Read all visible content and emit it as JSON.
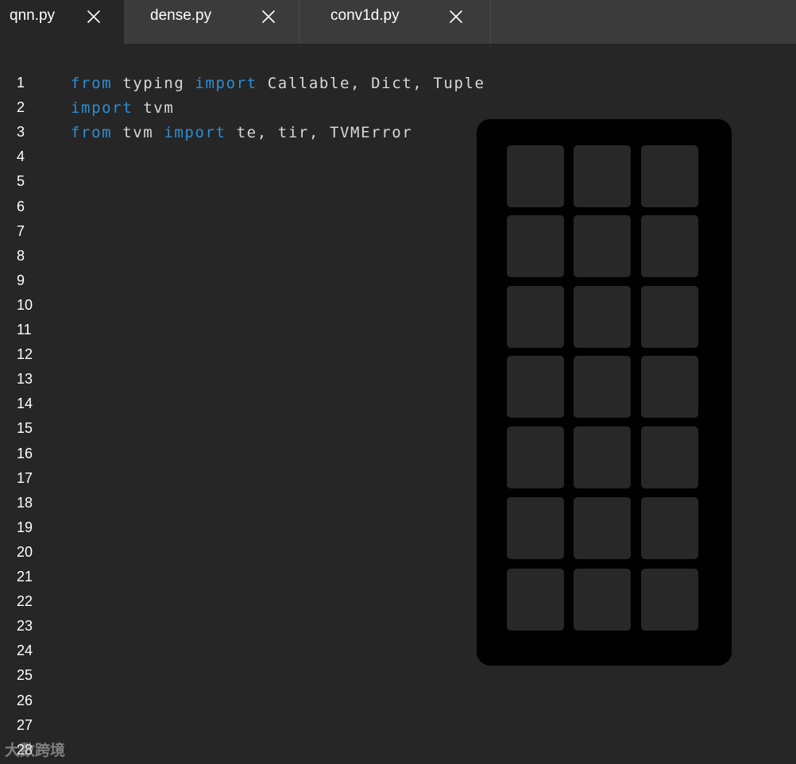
{
  "tabs": [
    {
      "label": "qnn.py",
      "active": true
    },
    {
      "label": "dense.py",
      "active": false
    },
    {
      "label": "conv1d.py",
      "active": false
    }
  ],
  "editor": {
    "line_numbers": [
      "1",
      "2",
      "3",
      "4",
      "5",
      "6",
      "7",
      "8",
      "9",
      "10",
      "11",
      "12",
      "13",
      "14",
      "15",
      "16",
      "17",
      "18",
      "19",
      "20",
      "21",
      "22",
      "23",
      "24",
      "25",
      "26",
      "27",
      "28"
    ],
    "code_lines": [
      [
        {
          "t": "from",
          "kw": true
        },
        {
          "t": " typing ",
          "kw": false
        },
        {
          "t": "import",
          "kw": true
        },
        {
          "t": " Callable, Dict, Tuple",
          "kw": false
        }
      ],
      [
        {
          "t": "import",
          "kw": true
        },
        {
          "t": " tvm",
          "kw": false
        }
      ],
      [
        {
          "t": "from",
          "kw": true
        },
        {
          "t": " tvm ",
          "kw": false
        },
        {
          "t": "import",
          "kw": true
        },
        {
          "t": " te, tir, TVMError",
          "kw": false
        }
      ]
    ]
  },
  "keypad": {
    "rows": 7,
    "cols": 3
  },
  "watermark": {
    "text": "大数跨境"
  },
  "colors": {
    "background": "#262626",
    "tabbar": "#3b3b3b",
    "keyword": "#2d8ed2",
    "text": "#d8d8d8",
    "keypad_bg": "#010101",
    "key_bg": "#282828"
  },
  "icons": {
    "tab_close": "close-icon"
  }
}
